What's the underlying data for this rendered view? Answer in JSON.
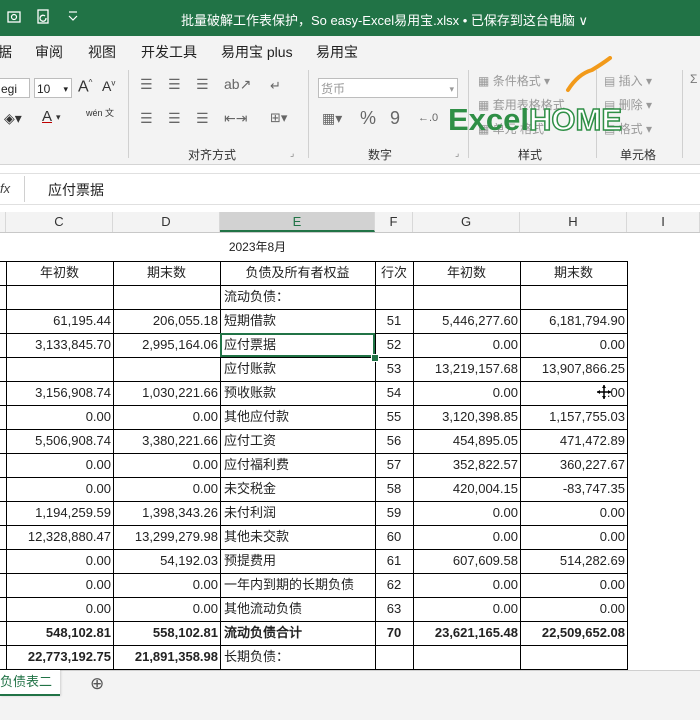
{
  "title_bar": {
    "title": "批量破解工作表保护，So easy-Excel易用宝.xlsx • 已保存到这台电脑 ∨",
    "qa_icons": [
      "screenshot-icon",
      "refresh-doc-icon",
      "customize-qat-icon"
    ]
  },
  "ribbon_tabs": [
    "据",
    "审阅",
    "视图",
    "开发工具",
    "易用宝 plus",
    "易用宝"
  ],
  "ribbon": {
    "font_name": "egi",
    "font_size": "10",
    "number_format": "货币",
    "align_group": "对齐方式",
    "number_group": "数字",
    "style_group": "样式",
    "cells_group": "单元格",
    "cond_format": "条件格式",
    "table_format": "套用表格格式",
    "cell_style": "格式",
    "insert": "插入",
    "delete": "删除",
    "format": "格式",
    "wen_label": "wén 文",
    "percent": "%",
    "comma": "9",
    "watermark": "ExcelHOME",
    "accent": "#217346"
  },
  "formula_bar": {
    "fx": "fx",
    "content": "应付票据"
  },
  "columns": [
    "C",
    "D",
    "E",
    "F",
    "G",
    "H",
    "I"
  ],
  "sheet": {
    "date_header": "2023年8月",
    "headers": [
      "年初数",
      "期末数",
      "负债及所有者权益",
      "行次",
      "年初数",
      "期末数"
    ],
    "rows": [
      [
        "",
        "",
        "流动负债：",
        "",
        "",
        ""
      ],
      [
        "61,195.44",
        "206,055.18",
        "短期借款",
        "51",
        "5,446,277.60",
        "6,181,794.90"
      ],
      [
        "3,133,845.70",
        "2,995,164.06",
        "应付票据",
        "52",
        "0.00",
        "0.00"
      ],
      [
        "",
        "",
        "应付账款",
        "53",
        "13,219,157.68",
        "13,907,866.25"
      ],
      [
        "3,156,908.74",
        "1,030,221.66",
        "预收账款",
        "54",
        "0.00",
        ".00"
      ],
      [
        "0.00",
        "0.00",
        "其他应付款",
        "55",
        "3,120,398.85",
        "1,157,755.03"
      ],
      [
        "5,506,908.74",
        "3,380,221.66",
        "应付工资",
        "56",
        "454,895.05",
        "471,472.89"
      ],
      [
        "0.00",
        "0.00",
        "应付福利费",
        "57",
        "352,822.57",
        "360,227.67"
      ],
      [
        "0.00",
        "0.00",
        "未交税金",
        "58",
        "420,004.15",
        "-83,747.35"
      ],
      [
        "1,194,259.59",
        "1,398,343.26",
        "未付利润",
        "59",
        "0.00",
        "0.00"
      ],
      [
        "12,328,880.47",
        "13,299,279.98",
        "其他未交款",
        "60",
        "0.00",
        "0.00"
      ],
      [
        "0.00",
        "54,192.03",
        "预提费用",
        "61",
        "607,609.58",
        "514,282.69"
      ],
      [
        "0.00",
        "0.00",
        "一年内到期的长期负债",
        "62",
        "0.00",
        "0.00"
      ],
      [
        "0.00",
        "0.00",
        "其他流动负债",
        "63",
        "0.00",
        "0.00"
      ],
      [
        "548,102.81",
        "558,102.81",
        "流动负债合计",
        "70",
        "23,621,165.48",
        "22,509,652.08"
      ],
      [
        "22,773,192.75",
        "21,891,358.98",
        "长期负债：",
        "",
        "",
        ""
      ]
    ],
    "selected_cell": "E 应付票据"
  },
  "sheet_tabs": {
    "active": "负债表二",
    "add": "⊕"
  }
}
